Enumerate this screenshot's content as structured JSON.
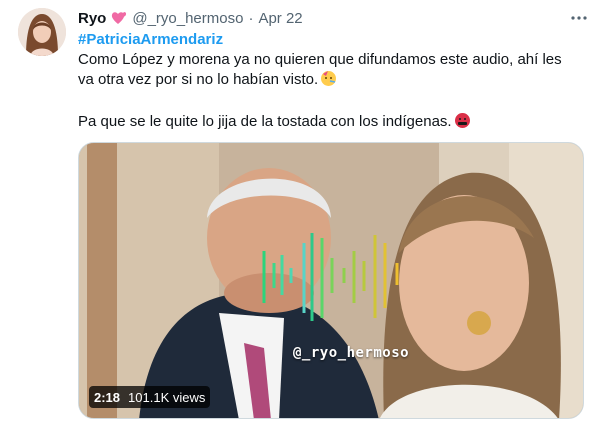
{
  "tweet": {
    "display_name": "Ryo",
    "name_emoji": "heart-emoji",
    "handle": "@_ryo_hermoso",
    "separator": "·",
    "date": "Apr 22",
    "more_icon": "more-dots-icon",
    "hashtag": "#PatriciaArmendariz",
    "text_line1": "Como López y morena ya no quieren que difundamos este audio, ahí les",
    "text_line2": "va otra vez por si no lo habían visto.",
    "text_line2_emoji": "party-face-emoji",
    "text_line3": "Pa que se le quite lo jija de la tostada con los indígenas.",
    "text_line3_emoji": "cursing-face-emoji"
  },
  "media": {
    "watermark": "@_ryo_hermoso",
    "duration": "2:18",
    "views": "101.1K views"
  },
  "colors": {
    "link": "#1d9bf0",
    "secondary_text": "#536471",
    "primary_text": "#0f1419"
  }
}
